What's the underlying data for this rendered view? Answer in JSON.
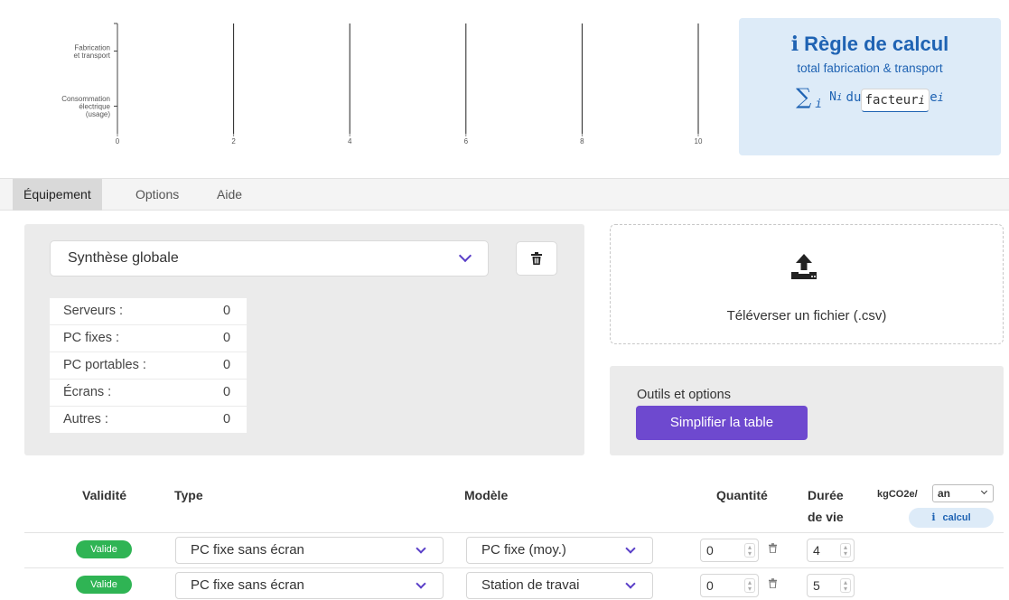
{
  "chart_data": {
    "type": "bar",
    "orientation": "horizontal",
    "categories": [
      "Fabrication et transport",
      "Consommation électrique (usage)"
    ],
    "category_lines": [
      [
        "Fabrication",
        "et transport"
      ],
      [
        "Consommation",
        "électrique",
        "(usage)"
      ]
    ],
    "x_ticks": [
      "0",
      "2",
      "4",
      "6",
      "8",
      "10"
    ],
    "xlim": [
      0,
      10
    ],
    "series": [
      {
        "values": [
          0,
          0
        ]
      }
    ],
    "grid": "vertical"
  },
  "rule": {
    "info_glyph": "i",
    "title": "Règle de calcul",
    "subtitle": "total fabrication & transport",
    "sum_symbol": "∑",
    "sum_index": "i",
    "n_symbol": "N",
    "n_index": "i",
    "numerator": "facteur",
    "numerator_index": "i",
    "denominator": "durée de vie",
    "denominator_index": "i"
  },
  "tabs": [
    {
      "label": "Équipement",
      "active": true
    },
    {
      "label": "Options",
      "active": false
    },
    {
      "label": "Aide",
      "active": false
    }
  ],
  "synthesis": {
    "selected": "Synthèse globale",
    "stats": [
      {
        "label": "Serveurs :",
        "value": "0"
      },
      {
        "label": "PC fixes :",
        "value": "0"
      },
      {
        "label": "PC portables :",
        "value": "0"
      },
      {
        "label": "Écrans :",
        "value": "0"
      },
      {
        "label": "Autres :",
        "value": "0"
      }
    ]
  },
  "upload": {
    "label": "Téléverser un fichier (.csv)",
    "icon": "upload-icon"
  },
  "tools": {
    "label": "Outils et options",
    "button": "Simplifier la table"
  },
  "table": {
    "headers": {
      "validity": "Validité",
      "type": "Type",
      "model": "Modèle",
      "quantity": "Quantité",
      "lifetime_line1": "Durée",
      "lifetime_line2": "de vie",
      "unit": "kgCO2e/",
      "period": "an",
      "calc_info": "i",
      "calc": "calcul"
    },
    "rows": [
      {
        "status": "Valide",
        "type": "PC fixe sans écran",
        "model": "PC fixe (moy.)",
        "quantity": "0",
        "lifetime": "4"
      },
      {
        "status": "Valide",
        "type": "PC fixe sans écran",
        "model": "Station de travai",
        "quantity": "0",
        "lifetime": "5"
      }
    ]
  },
  "colors": {
    "accent": "#6e49cf",
    "info_blue": "#1f63b3",
    "info_bg": "#ddebf8",
    "valid_green": "#2fb454",
    "panel_gray": "#ebebeb"
  }
}
